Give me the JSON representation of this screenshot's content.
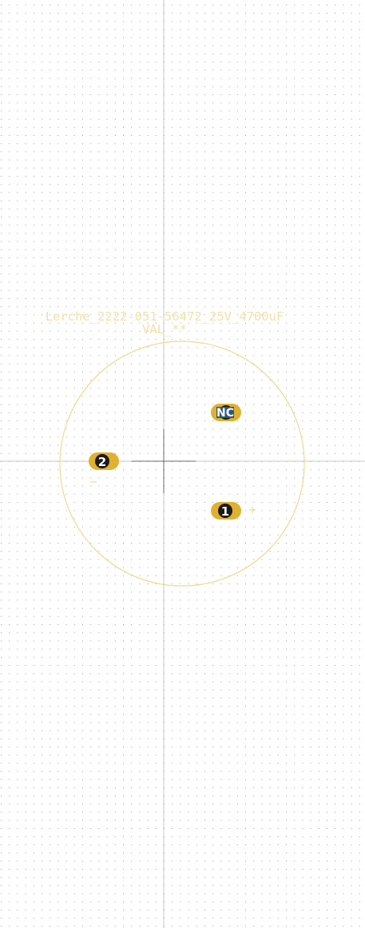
{
  "footprint": {
    "reference_text": "Lerche_2222-051-56472_25V_4700uF",
    "value_text": "VAL_**",
    "pads": [
      {
        "id": "pad-1",
        "label": "1",
        "polarity_mark": "+"
      },
      {
        "id": "pad-2",
        "label": "2",
        "polarity_mark": "−"
      },
      {
        "id": "pad-nc",
        "label": "NC"
      }
    ]
  },
  "colors": {
    "background": "#ffffff",
    "grid_dot": "#9c9c9c",
    "axis_line": "#c9c9c9",
    "origin_cross": "#6b6b6b",
    "courtyard_circle": "#f0d890",
    "silkscreen_text": "#f2e0a8",
    "pad_fill": "#e0b030",
    "pad_hole": "#1a1a1a",
    "pad_label": "#ffffff"
  }
}
